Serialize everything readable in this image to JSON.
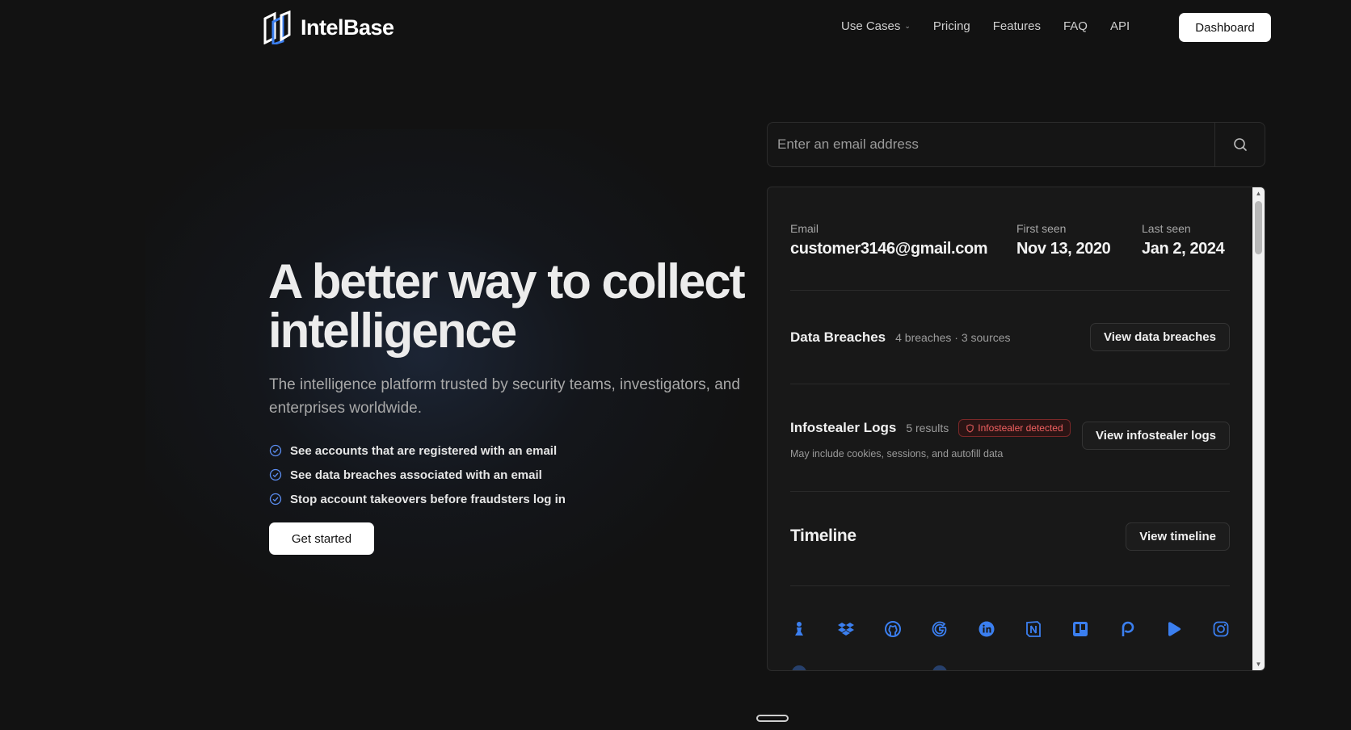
{
  "brand": {
    "name": "IntelBase",
    "accent": "#3b7ff0"
  },
  "nav": {
    "items": [
      {
        "label": "Use Cases",
        "has_dropdown": true
      },
      {
        "label": "Pricing"
      },
      {
        "label": "Features"
      },
      {
        "label": "FAQ"
      },
      {
        "label": "API"
      }
    ],
    "dashboard_label": "Dashboard"
  },
  "hero": {
    "title_line1": "A better way to collect",
    "title_line2": "intelligence",
    "subtitle": "The intelligence platform trusted by security teams, investigators, and enterprises worldwide.",
    "features": [
      "See accounts that are registered with an email",
      "See data breaches associated with an email",
      "Stop account takeovers before fraudsters log in"
    ],
    "cta_label": "Get started"
  },
  "search": {
    "placeholder": "Enter an email address",
    "icon": "search-icon"
  },
  "result": {
    "email_label": "Email",
    "email_value": "customer3146@gmail.com",
    "first_seen_label": "First seen",
    "first_seen_value": "Nov 13, 2020",
    "last_seen_label": "Last seen",
    "last_seen_value": "Jan 2, 2024",
    "breaches": {
      "title": "Data Breaches",
      "meta": "4 breaches · 3 sources",
      "button": "View data breaches"
    },
    "infostealer": {
      "title": "Infostealer Logs",
      "meta": "5 results",
      "badge": "Infostealer detected",
      "badge_color": "#f06060",
      "note": "May include cookies, sessions, and autofill data",
      "button": "View infostealer logs"
    },
    "timeline": {
      "title": "Timeline",
      "button": "View timeline"
    },
    "service_icons": [
      "chess-pawn-icon",
      "dropbox-icon",
      "github-icon",
      "google-icon",
      "linkedin-icon",
      "notion-icon",
      "trello-icon",
      "patreon-icon",
      "play-icon",
      "instagram-icon"
    ]
  }
}
